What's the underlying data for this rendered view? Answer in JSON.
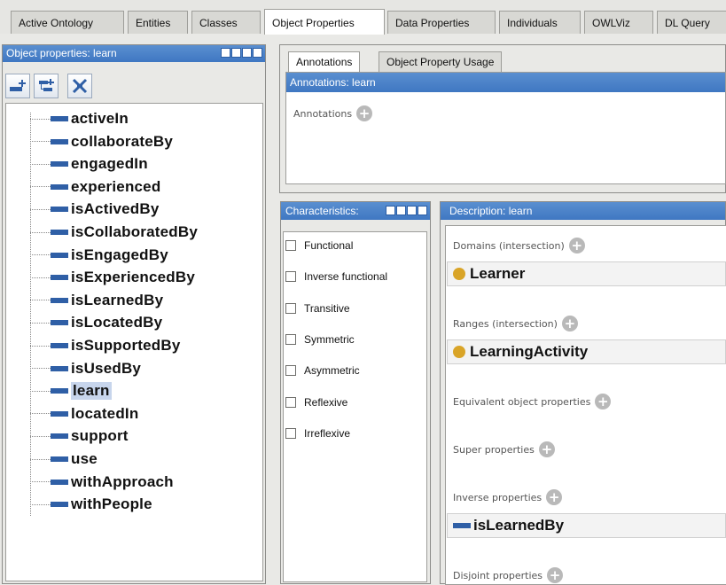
{
  "tabs": [
    {
      "label": "Active Ontology",
      "active": false
    },
    {
      "label": "Entities",
      "active": false
    },
    {
      "label": "Classes",
      "active": false
    },
    {
      "label": "Object Properties",
      "active": true
    },
    {
      "label": "Data Properties",
      "active": false
    },
    {
      "label": "Individuals",
      "active": false
    },
    {
      "label": "OWLViz",
      "active": false
    },
    {
      "label": "DL Query",
      "active": false
    }
  ],
  "hierarchy": {
    "title": "Object properties: learn",
    "toolbar": [
      "add-subproperty-icon",
      "add-sibling-property-icon",
      "delete-property-icon"
    ],
    "items": [
      "activeIn",
      "collaborateBy",
      "engagedIn",
      "experienced",
      "isActivedBy",
      "isCollaboratedBy",
      "isEngagedBy",
      "isExperiencedBy",
      "isLearnedBy",
      "isLocatedBy",
      "isSupportedBy",
      "isUsedBy",
      "learn",
      "locatedIn",
      "support",
      "use",
      "withApproach",
      "withPeople"
    ],
    "selected": "learn"
  },
  "annotations_panel": {
    "tabs": [
      "Annotations",
      "Object Property Usage"
    ],
    "title": "Annotations: learn",
    "section_label": "Annotations"
  },
  "characteristics": {
    "title": "Characteristics:",
    "items": [
      "Functional",
      "Inverse functional",
      "Transitive",
      "Symmetric",
      "Asymmetric",
      "Reflexive",
      "Irreflexive"
    ]
  },
  "description": {
    "title": "Description: learn",
    "domains_label": "Domains (intersection)",
    "domain_value": "Learner",
    "ranges_label": "Ranges (intersection)",
    "range_value": "LearningActivity",
    "equivalent_label": "Equivalent object properties",
    "super_label": "Super properties",
    "inverse_label": "Inverse properties",
    "inverse_value": "isLearnedBy",
    "disjoint_label": "Disjoint properties"
  },
  "colors": {
    "titlebar": "#4a83c8",
    "property_icon": "#2f5fa6",
    "class_dot": "#d9a427",
    "selection": "#c7d5ec"
  },
  "plus_glyph": "+"
}
